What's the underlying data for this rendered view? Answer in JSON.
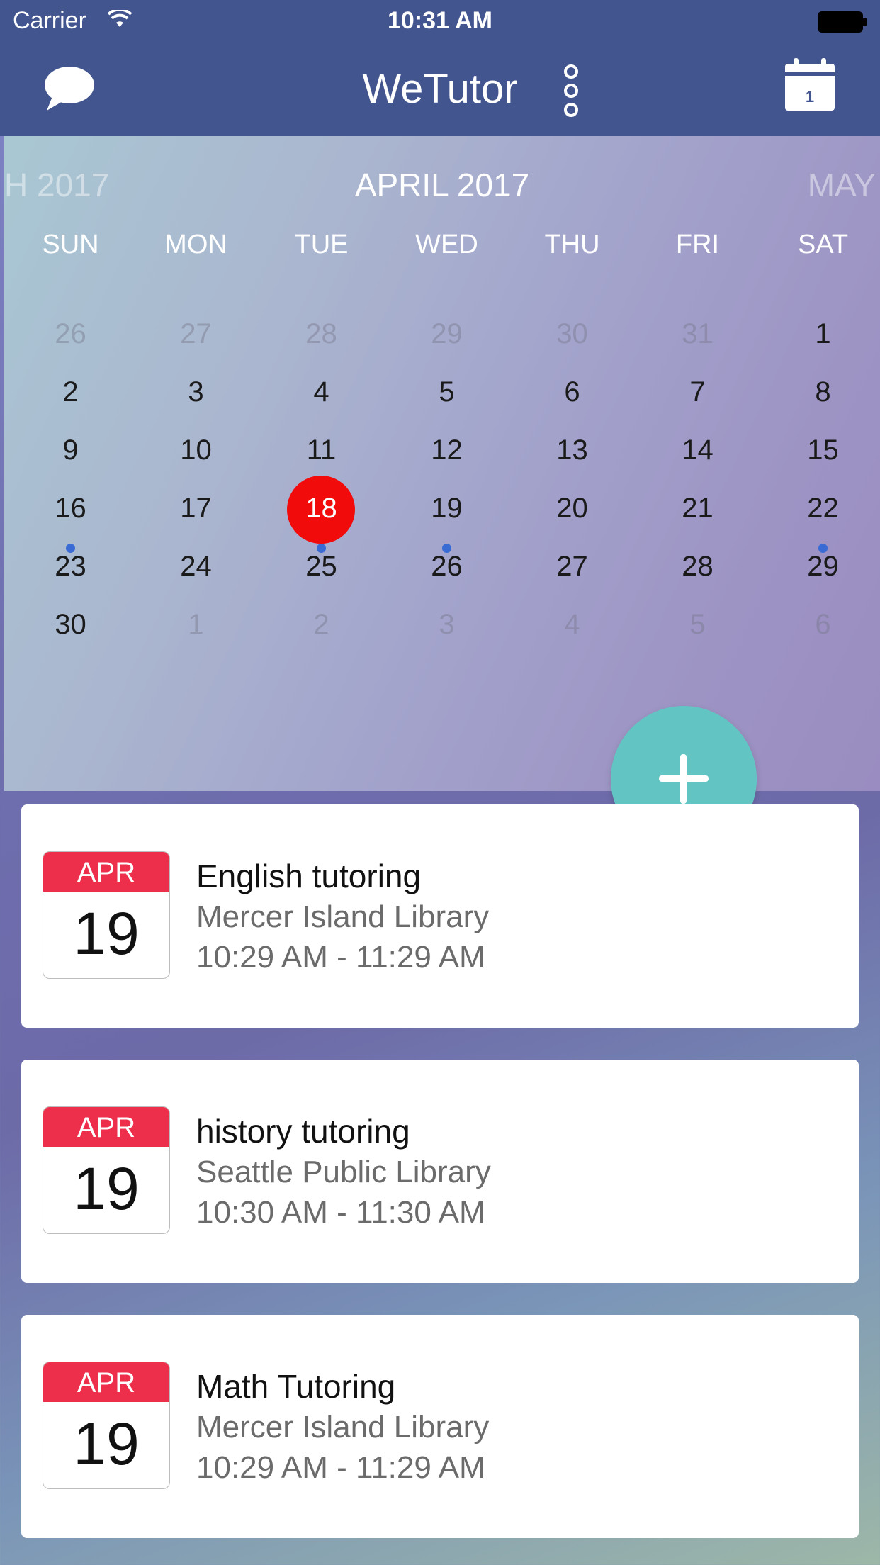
{
  "status_bar": {
    "carrier": "Carrier",
    "time": "10:31 AM",
    "wifi_icon": "wifi-icon",
    "battery_icon": "battery-icon"
  },
  "nav_bar": {
    "title": "WeTutor",
    "left_icon": "chat-bubble-icon",
    "overflow_icon": "more-vertical-icon",
    "right_icon": "calendar-icon",
    "calendar_icon_day": "1"
  },
  "calendar": {
    "prev_month": "H 2017",
    "month": "APRIL 2017",
    "next_month": "MAY",
    "weekdays": [
      "SUN",
      "MON",
      "TUE",
      "WED",
      "THU",
      "FRI",
      "SAT"
    ],
    "weeks": [
      [
        "26",
        "27",
        "28",
        "29",
        "30",
        "31",
        "1"
      ],
      [
        "2",
        "3",
        "4",
        "5",
        "6",
        "7",
        "8"
      ],
      [
        "9",
        "10",
        "11",
        "12",
        "13",
        "14",
        "15"
      ],
      [
        "16",
        "17",
        "18",
        "19",
        "20",
        "21",
        "22"
      ],
      [
        "23",
        "24",
        "25",
        "26",
        "27",
        "28",
        "29"
      ],
      [
        "30",
        "1",
        "2",
        "3",
        "4",
        "5",
        "6"
      ]
    ],
    "selected_day": "18",
    "selected_color": "#f20b0b",
    "event_dot_color": "#3a6ad3",
    "event_dot_days": [
      "16",
      "18",
      "19",
      "22"
    ]
  },
  "fab": {
    "icon": "plus-icon",
    "color": "#62c5c3"
  },
  "events": [
    {
      "badge_month": "APR",
      "badge_day": "19",
      "title": "English tutoring",
      "location": "Mercer Island Library",
      "time": "10:29 AM - 11:29 AM"
    },
    {
      "badge_month": "APR",
      "badge_day": "19",
      "title": "history tutoring",
      "location": "Seattle Public Library",
      "time": "10:30 AM - 11:30 AM"
    },
    {
      "badge_month": "APR",
      "badge_day": "19",
      "title": "Math Tutoring",
      "location": "Mercer Island Library",
      "time": "10:29 AM - 11:29 AM"
    }
  ],
  "colors": {
    "header": "#43558f",
    "badge_red": "#ee2f4c"
  }
}
